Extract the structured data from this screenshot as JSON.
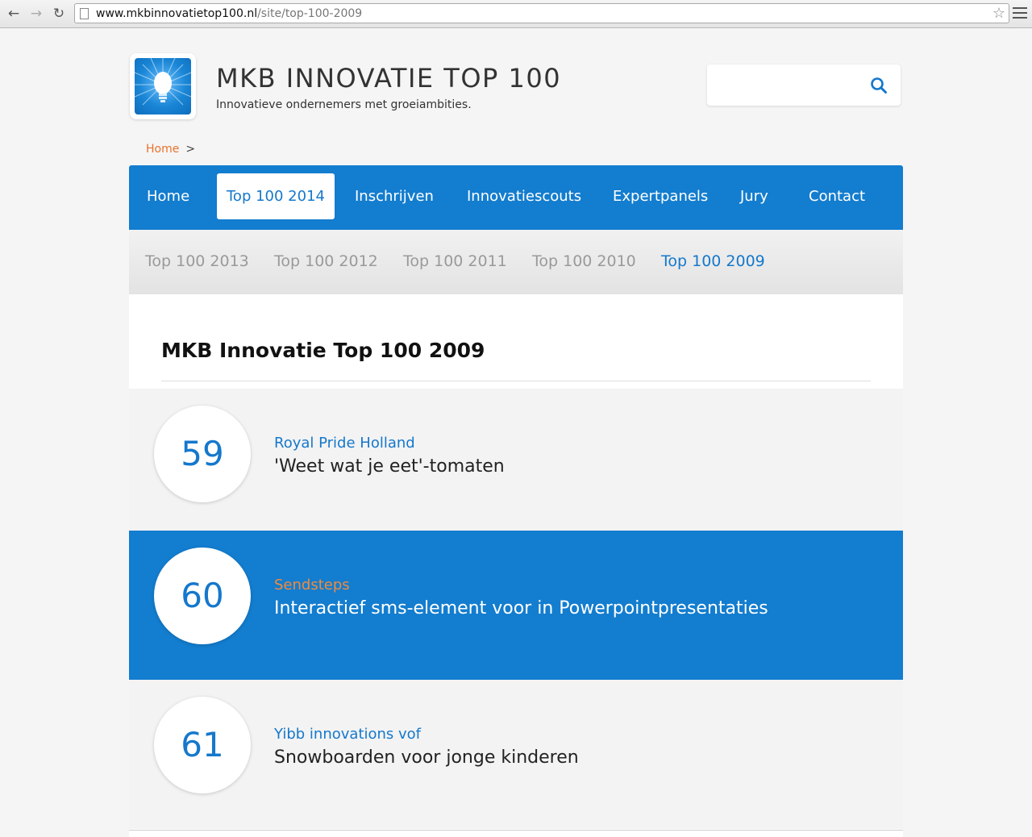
{
  "browser": {
    "url_host": "www.mkbinnovatietop100.nl",
    "url_path": "/site/top-100-2009"
  },
  "header": {
    "title": "MKB INNOVATIE TOP 100",
    "tagline": "Innovatieve ondernemers met groeiambities.",
    "search": {
      "value": "",
      "placeholder": ""
    }
  },
  "breadcrumb": {
    "home": "Home",
    "separator": ">"
  },
  "main_nav": [
    {
      "label": "Home",
      "active": false
    },
    {
      "label": "Top 100 2014",
      "active": true
    },
    {
      "label": "Inschrijven",
      "active": false
    },
    {
      "label": "Innovatiescouts",
      "active": false
    },
    {
      "label": "Expertpanels",
      "active": false
    },
    {
      "label": "Jury",
      "active": false
    },
    {
      "label": "Contact",
      "active": false
    }
  ],
  "sub_nav": [
    {
      "label": "Top 100 2013",
      "active": false
    },
    {
      "label": "Top 100 2012",
      "active": false
    },
    {
      "label": "Top 100 2011",
      "active": false
    },
    {
      "label": "Top 100 2010",
      "active": false
    },
    {
      "label": "Top 100 2009",
      "active": true
    }
  ],
  "page": {
    "heading": "MKB Innovatie Top 100 2009"
  },
  "entries": [
    {
      "rank": "59",
      "company": "Royal Pride Holland",
      "product": "'Weet wat je eet'-tomaten",
      "highlighted": false
    },
    {
      "rank": "60",
      "company": "Sendsteps",
      "product": "Interactief sms-element voor in Powerpointpresentaties",
      "highlighted": true
    },
    {
      "rank": "61",
      "company": "Yibb innovations vof",
      "product": "Snowboarden voor jonge kinderen",
      "highlighted": false
    }
  ],
  "colors": {
    "brand_blue": "#137dcf",
    "link_blue": "#1578cc",
    "accent_orange": "#e8732c"
  },
  "icons": {
    "back": "arrow-left-icon",
    "forward": "arrow-right-icon",
    "reload": "reload-icon",
    "bookmark": "star-icon",
    "menu": "hamburger-icon",
    "search": "search-icon",
    "logo": "lightbulb-icon"
  }
}
